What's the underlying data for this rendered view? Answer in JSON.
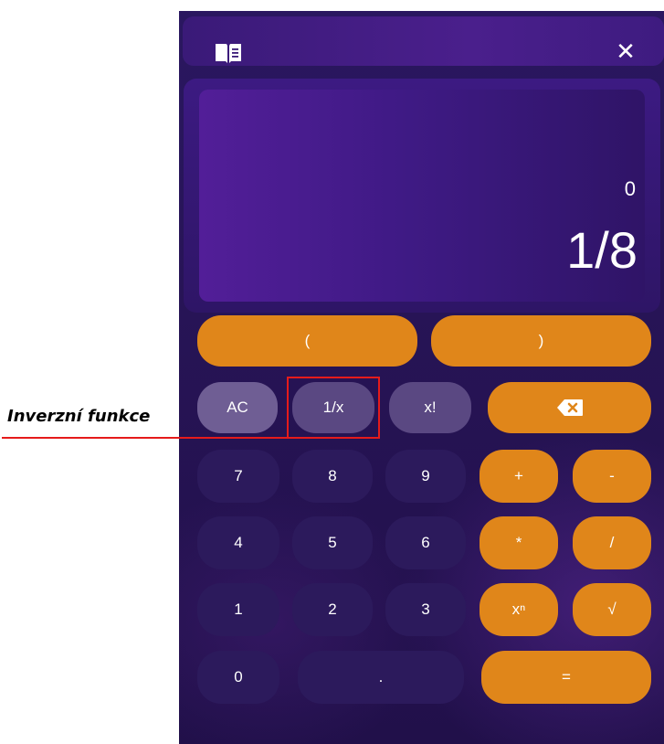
{
  "window": {
    "close_glyph": "✕",
    "icons": {
      "manual": "book-icon",
      "close": "close-icon",
      "backspace": "backspace-icon"
    }
  },
  "display": {
    "previous": "0",
    "current": "1/8"
  },
  "buttons": {
    "paren_open": "(",
    "paren_close": ")",
    "ac": "AC",
    "inverse": "1/x",
    "factorial": "x!",
    "seven": "7",
    "eight": "8",
    "nine": "9",
    "plus": "+",
    "minus": "-",
    "four": "4",
    "five": "5",
    "six": "6",
    "multiply": "*",
    "divide": "/",
    "one": "1",
    "two": "2",
    "three": "3",
    "power": "xⁿ",
    "sqrt": "√",
    "zero": "0",
    "decimal": ".",
    "equals": "="
  },
  "annotation": {
    "label": "Inverzní funkce",
    "color": "#e51b1b"
  },
  "colors": {
    "accent": "#e0861a",
    "background": "#271456",
    "function_key": "#5a4882",
    "digit_key": "#2c1a5c"
  }
}
